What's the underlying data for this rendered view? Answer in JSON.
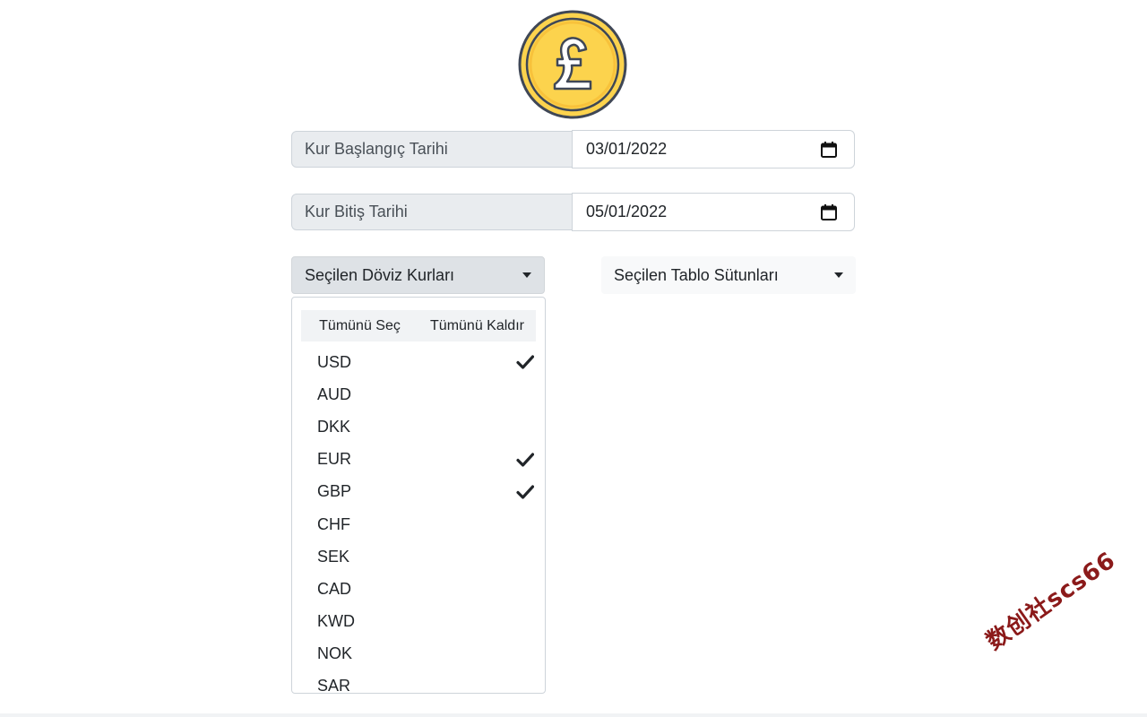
{
  "logo": {
    "icon": "pound-coin-icon",
    "colors": {
      "coin": "#fcd34d",
      "outline": "#3f4756",
      "symbol": "#ffffff"
    }
  },
  "start_date": {
    "label": "Kur Başlangıç Tarihi",
    "value": "03/01/2022",
    "icon": "calendar-icon"
  },
  "end_date": {
    "label": "Kur Bitiş Tarihi",
    "value": "05/01/2022",
    "icon": "calendar-icon"
  },
  "currency_dropdown": {
    "label": "Seçilen Döviz Kurları",
    "select_all": "Tümünü Seç",
    "clear_all": "Tümünü Kaldır",
    "items": [
      {
        "code": "USD",
        "checked": true
      },
      {
        "code": "AUD",
        "checked": false
      },
      {
        "code": "DKK",
        "checked": false
      },
      {
        "code": "EUR",
        "checked": true
      },
      {
        "code": "GBP",
        "checked": true
      },
      {
        "code": "CHF",
        "checked": false
      },
      {
        "code": "SEK",
        "checked": false
      },
      {
        "code": "CAD",
        "checked": false
      },
      {
        "code": "KWD",
        "checked": false
      },
      {
        "code": "NOK",
        "checked": false
      },
      {
        "code": "SAR",
        "checked": false
      }
    ]
  },
  "columns_dropdown": {
    "label": "Seçilen Tablo Sütunları"
  },
  "watermark": {
    "text": "数创社scs66",
    "color": "#8b1a1a"
  }
}
